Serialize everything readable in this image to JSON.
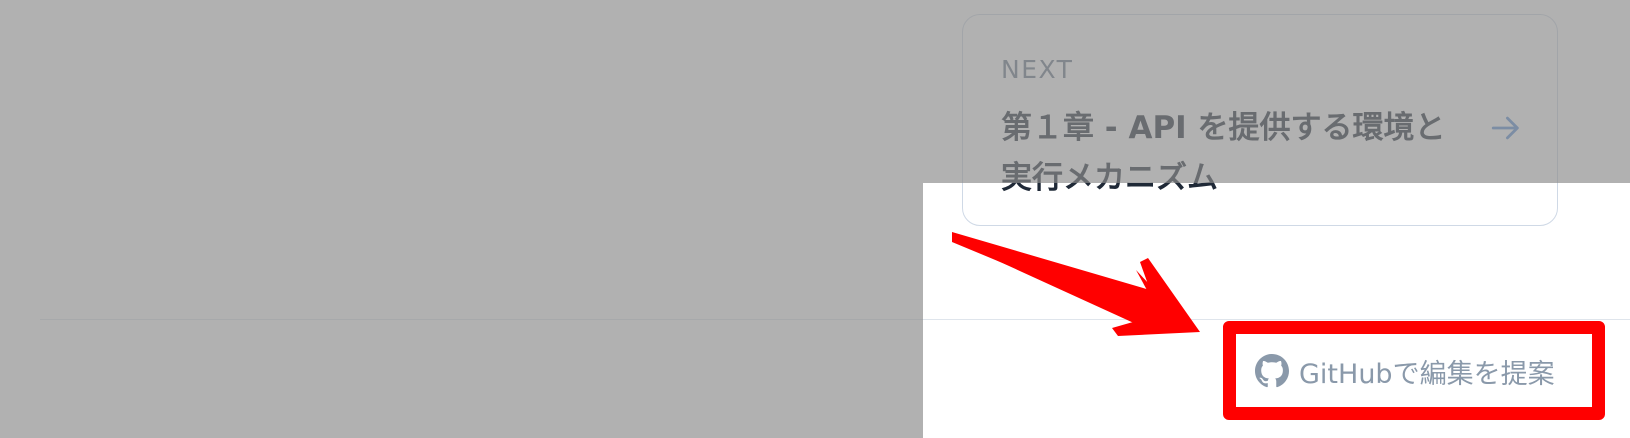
{
  "next_card": {
    "label": "NEXT",
    "title": "第１章 - API を提供する環境と実行メカニズム",
    "arrow_icon": "arrow-right-icon",
    "accent_color": "#5b8fd6"
  },
  "footer": {
    "edit_link_label": "GitHubで編集を提案",
    "edit_link_icon": "github-icon"
  },
  "annotation": {
    "highlight_color": "#ff0000",
    "arrow_icon": "annotation-arrow-icon"
  }
}
